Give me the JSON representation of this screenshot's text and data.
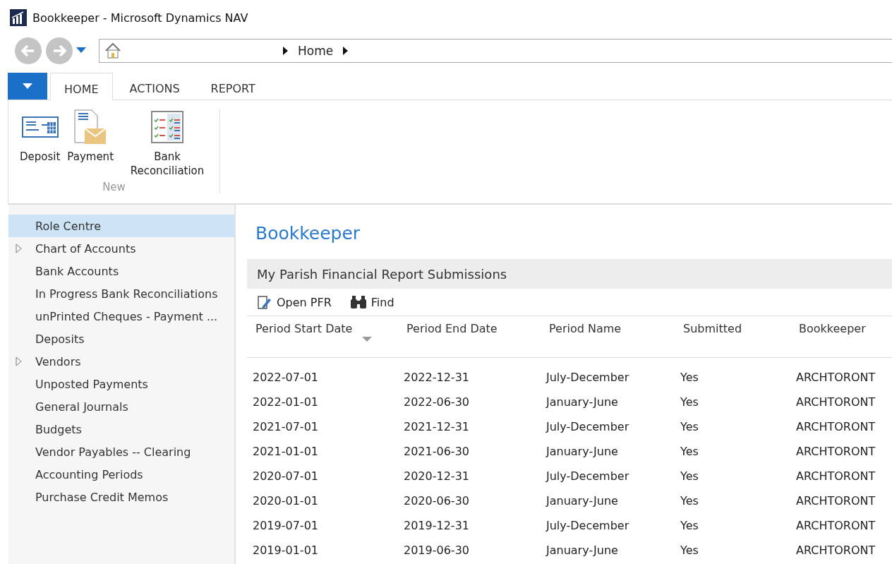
{
  "window": {
    "title": "Bookkeeper - Microsoft Dynamics NAV"
  },
  "address_bar": {
    "crumbs": [
      "Home"
    ]
  },
  "ribbon": {
    "tabs": [
      {
        "label": "HOME",
        "selected": true
      },
      {
        "label": "ACTIONS",
        "selected": false
      },
      {
        "label": "REPORT",
        "selected": false
      }
    ],
    "groups": [
      {
        "label": "New",
        "actions": [
          {
            "label": "Deposit",
            "kind": "deposit"
          },
          {
            "label": "Payment",
            "kind": "payment"
          },
          {
            "label": "Bank Reconciliation",
            "kind": "reconcile"
          }
        ]
      }
    ]
  },
  "sidebar": {
    "items": [
      {
        "label": "Role Centre",
        "selected": true,
        "expandable": false
      },
      {
        "label": "Chart of Accounts",
        "selected": false,
        "expandable": true
      },
      {
        "label": "Bank Accounts",
        "selected": false,
        "expandable": false
      },
      {
        "label": "In Progress Bank Reconciliations",
        "selected": false,
        "expandable": false
      },
      {
        "label": "unPrinted Cheques - Payment ...",
        "selected": false,
        "expandable": false
      },
      {
        "label": "Deposits",
        "selected": false,
        "expandable": false
      },
      {
        "label": "Vendors",
        "selected": false,
        "expandable": true
      },
      {
        "label": "Unposted Payments",
        "selected": false,
        "expandable": false
      },
      {
        "label": "General Journals",
        "selected": false,
        "expandable": false
      },
      {
        "label": "Budgets",
        "selected": false,
        "expandable": false
      },
      {
        "label": "Vendor Payables -- Clearing",
        "selected": false,
        "expandable": false
      },
      {
        "label": "Accounting Periods",
        "selected": false,
        "expandable": false
      },
      {
        "label": "Purchase Credit Memos",
        "selected": false,
        "expandable": false
      }
    ]
  },
  "page": {
    "title": "Bookkeeper",
    "part": {
      "title": "My Parish Financial Report Submissions",
      "actions": [
        {
          "label": "Open PFR",
          "kind": "edit"
        },
        {
          "label": "Find",
          "kind": "find"
        }
      ],
      "table": {
        "columns": [
          {
            "label": "Period Start Date",
            "sorted": true
          },
          {
            "label": "Period End Date",
            "sorted": false
          },
          {
            "label": "Period Name",
            "sorted": false
          },
          {
            "label": "Submitted",
            "sorted": false
          },
          {
            "label": "Bookkeeper",
            "sorted": false
          }
        ],
        "rows": [
          [
            "2022-07-01",
            "2022-12-31",
            "July-December",
            "Yes",
            "ARCHTORONT"
          ],
          [
            "2022-01-01",
            "2022-06-30",
            "January-June",
            "Yes",
            "ARCHTORONT"
          ],
          [
            "2021-07-01",
            "2021-12-31",
            "July-December",
            "Yes",
            "ARCHTORONT"
          ],
          [
            "2021-01-01",
            "2021-06-30",
            "January-June",
            "Yes",
            "ARCHTORONT"
          ],
          [
            "2020-07-01",
            "2020-12-31",
            "July-December",
            "Yes",
            "ARCHTORONT"
          ],
          [
            "2020-01-01",
            "2020-06-30",
            "January-June",
            "Yes",
            "ARCHTORONT"
          ],
          [
            "2019-07-01",
            "2019-12-31",
            "July-December",
            "Yes",
            "ARCHTORONT"
          ],
          [
            "2019-01-01",
            "2019-06-30",
            "January-June",
            "Yes",
            "ARCHTORONT"
          ]
        ]
      }
    }
  }
}
